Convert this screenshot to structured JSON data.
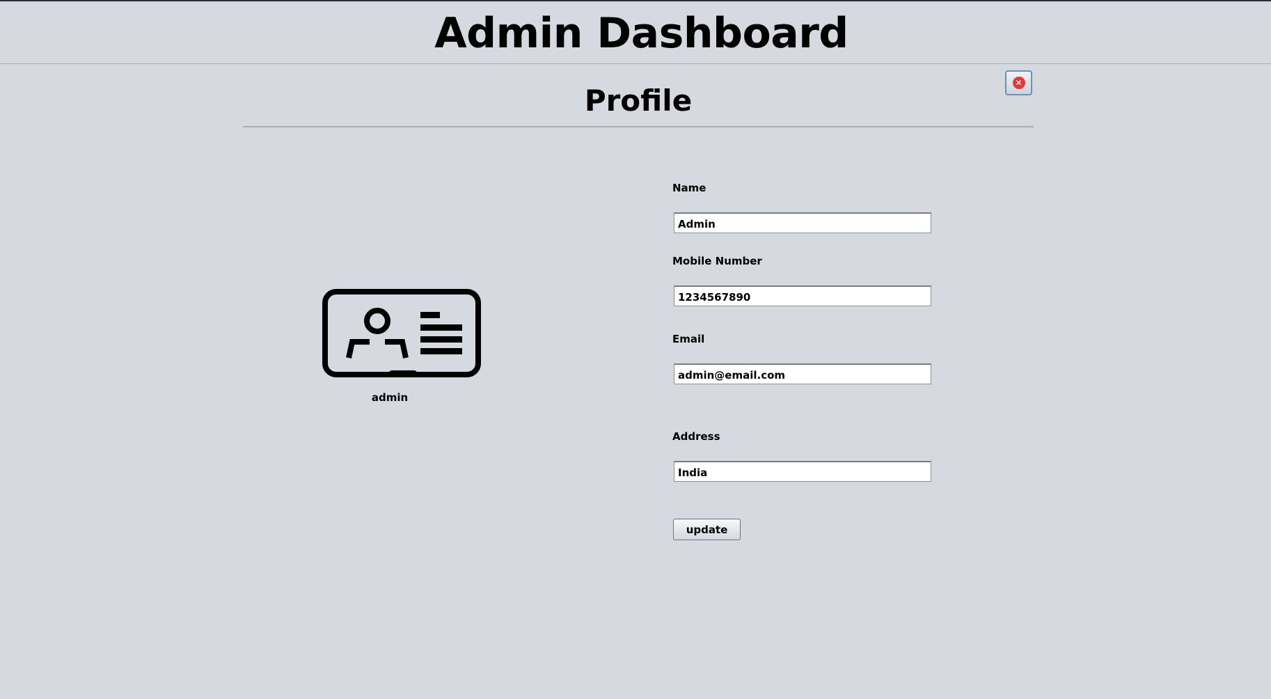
{
  "app": {
    "title": "Admin Dashboard"
  },
  "profile": {
    "heading": "Profile",
    "close_icon": "close-icon",
    "avatar_icon": "id-card-icon",
    "username": "admin",
    "accent_close": "#e23a3a"
  },
  "form": {
    "name": {
      "label": "Name",
      "value": "Admin"
    },
    "mobile": {
      "label": "Mobile Number",
      "value": "1234567890"
    },
    "email": {
      "label": "Email",
      "value": "admin@email.com"
    },
    "address": {
      "label": "Address",
      "value": "India"
    },
    "update_label": "update"
  }
}
